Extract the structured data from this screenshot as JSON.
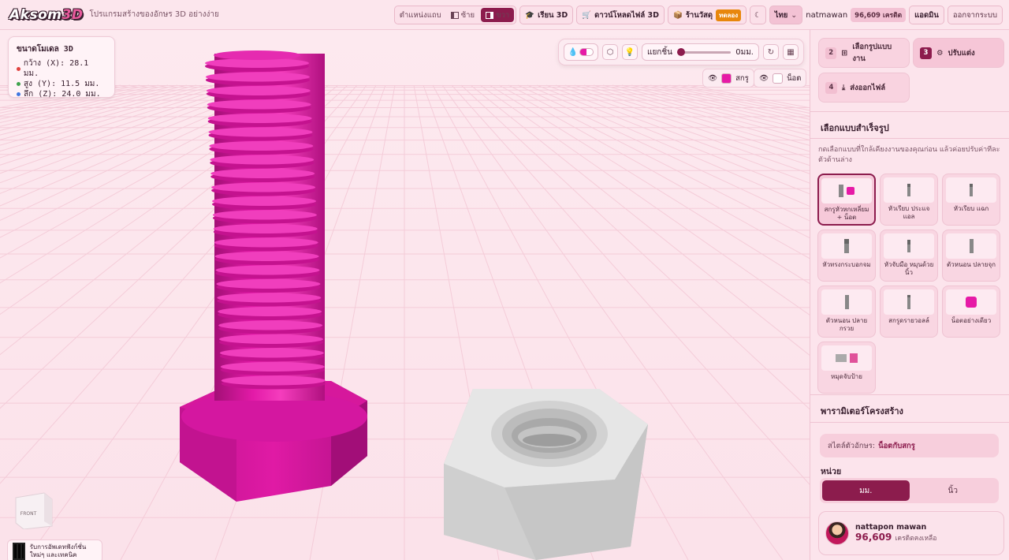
{
  "header": {
    "logo_main": "Aksom",
    "logo_accent": "3D",
    "tagline": "โปรแกรมสร้างของอักษร 3D อย่างง่าย",
    "panel_position_label": "ตำแหน่งแถบ",
    "panel_left": "ซ้าย",
    "panel_right": "ขวา",
    "learn_button": "เรียน 3D",
    "download_button": "ดาวน์โหลดไฟล์ 3D",
    "shop_button": "ร้านวัสดุ",
    "shop_badge": "ทดลอง",
    "language": "ไทย",
    "username": "natmawan",
    "credits": "96,609 เครดิต",
    "admin_button": "แอดมิน",
    "logout_button": "ออกจากระบบ"
  },
  "dimensions": {
    "title": "ขนาดโมเดล 3D",
    "width": "กว้าง (X): 28.1 มม.",
    "height": "สูง (Y): 11.5 มม.",
    "depth": "ลึก (Z): 24.0 มม.",
    "colors": {
      "x": "#e0433f",
      "y": "#3fa34d",
      "z": "#3f77e0"
    }
  },
  "viewport_toolbar": {
    "explode_label": "แยกชิ้น",
    "explode_value": "0มม.",
    "explode_fraction": 0
  },
  "parts": [
    {
      "label": "สกรู",
      "color": "#e61aa6"
    },
    {
      "label": "น็อต",
      "color": "#ffffff"
    }
  ],
  "view_cube": {
    "face": "FRONT"
  },
  "qr_promo": {
    "text": "รับการอัพเดทฟังก์ชั่นใหม่ๆ และเทคนิค"
  },
  "steps": [
    {
      "num": "2",
      "label": "เลือกรูปแบบงาน"
    },
    {
      "num": "3",
      "label": "ปรับแต่ง"
    },
    {
      "num": "4",
      "label": "ส่งออกไฟล์"
    }
  ],
  "template_section": {
    "title": "เลือกแบบสำเร็จรูป",
    "description": "กดเลือกแบบที่ใกล้เคียงงานของคุณก่อน แล้วค่อยปรับค่าทีละตัวด้านล่าง",
    "items": [
      "สกรูหัวหกเหลี่ยม + น็อต",
      "หัวเรียบ ประแจแอล",
      "หัวเรียบ แฉก",
      "หัวทรงกระบอกจม",
      "หัวจับมือ หมุนด้วยนิ้ว",
      "ตัวหนอน ปลายจุก",
      "ตัวหนอน ปลายกรวย",
      "สกรูดรายวอลล์",
      "น็อตอย่างเดียว",
      "หมุดจับป้าย"
    ]
  },
  "structure_section": {
    "title": "พารามิเตอร์โครงสร้าง",
    "style_label": "สไตล์ตัวอักษร:",
    "style_value": "น็อตกับสกรู",
    "unit_label": "หน่วย",
    "unit_mm": "มม.",
    "unit_inch": "นิ้ว"
  },
  "user_card": {
    "name": "nattapon mawan",
    "credits": "96,609",
    "credits_suffix": "เครดิตคงเหลือ"
  }
}
